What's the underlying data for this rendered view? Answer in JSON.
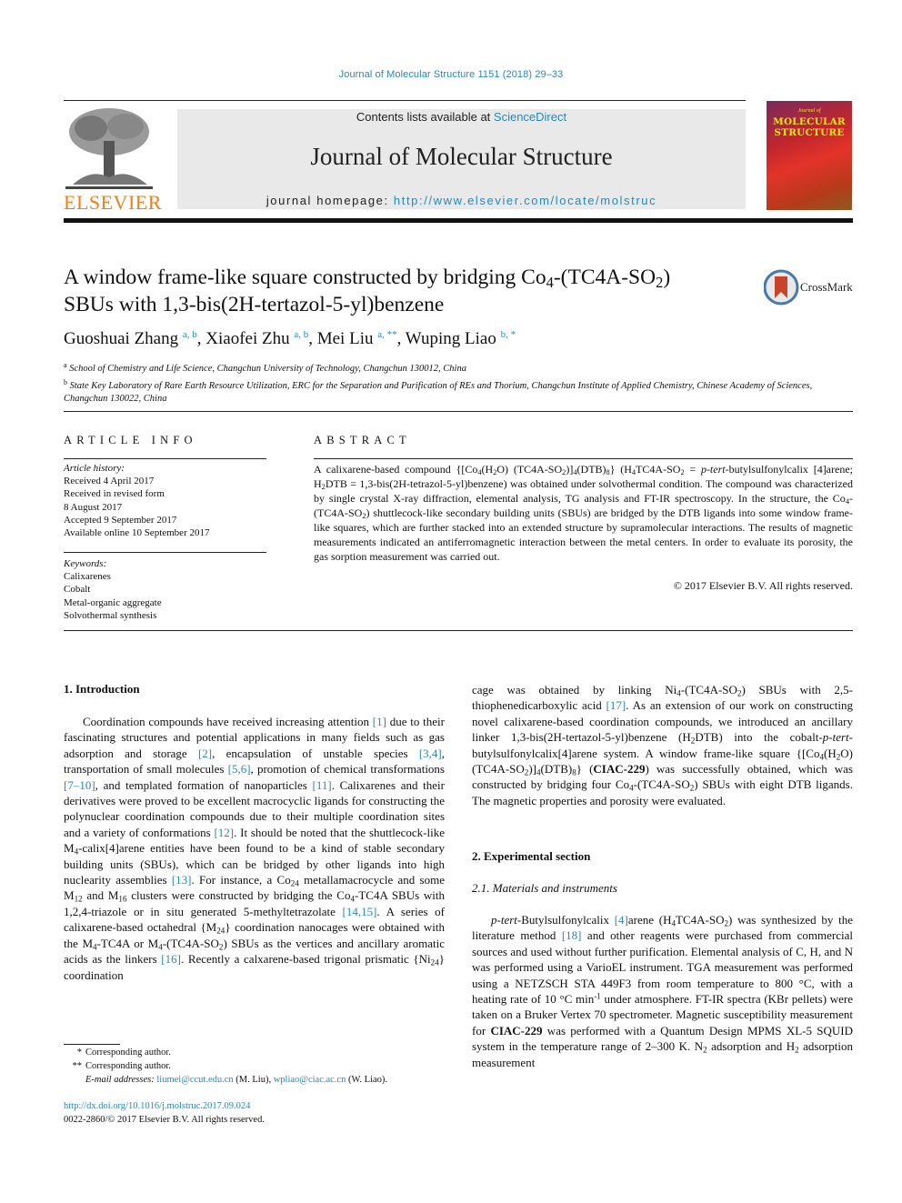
{
  "header": {
    "journal_ref": "Journal of Molecular Structure 1151 (2018) 29–33",
    "contents_prefix": "Contents lists available at ",
    "contents_link": "ScienceDirect",
    "journal_title": "Journal of Molecular Structure",
    "homepage_prefix": "journal homepage: ",
    "homepage_url": "http://www.elsevier.com/locate/molstruc",
    "publisher_logo": "ELSEVIER",
    "cover_small": "Journal of",
    "cover_line1": "MOLECULAR",
    "cover_line2": "STRUCTURE"
  },
  "article": {
    "title_part1": "A window frame-like square constructed by bridging Co",
    "title_sub1": "4",
    "title_part2": "-(TC4A-SO",
    "title_sub2": "2",
    "title_part3": ")",
    "title_line2": "SBUs with 1,3-bis(2H-tertazol-5-yl)benzene",
    "crossmark_label": "CrossMark",
    "authors": [
      {
        "name": "Guoshuai Zhang",
        "aff": "a, b",
        "sep": ", "
      },
      {
        "name": "Xiaofei Zhu",
        "aff": "a, b",
        "sep": ", "
      },
      {
        "name": "Mei Liu",
        "aff": "a, **",
        "sep": ", "
      },
      {
        "name": "Wuping Liao",
        "aff": "b, *",
        "sep": ""
      }
    ],
    "affiliations": [
      {
        "mark": "a",
        "text": "School of Chemistry and Life Science, Changchun University of Technology, Changchun 130012, China"
      },
      {
        "mark": "b",
        "text": "State Key Laboratory of Rare Earth Resource Utilization, ERC for the Separation and Purification of REs and Thorium, Changchun Institute of Applied Chemistry, Chinese Academy of Sciences, Changchun 130022, China"
      }
    ]
  },
  "article_info": {
    "heading": "ARTICLE INFO",
    "history_label": "Article history:",
    "history": [
      "Received 4 April 2017",
      "Received in revised form",
      "8 August 2017",
      "Accepted 9 September 2017",
      "Available online 10 September 2017"
    ],
    "keywords_label": "Keywords:",
    "keywords": [
      "Calixarenes",
      "Cobalt",
      "Metal-organic aggregate",
      "Solvothermal synthesis"
    ]
  },
  "abstract": {
    "heading": "ABSTRACT",
    "copyright": "© 2017 Elsevier B.V. All rights reserved."
  },
  "sections": {
    "intro_heading": "1.  Introduction",
    "exp_heading": "2.  Experimental section",
    "sub_heading": "2.1.  Materials and instruments"
  },
  "footnotes": {
    "star1": "*",
    "star1_text": "Corresponding author.",
    "star2": "**",
    "star2_text": "Corresponding author.",
    "email_label": "E-mail addresses:",
    "email1": "liumei@ccut.edu.cn",
    "email1_owner": " (M. Liu), ",
    "email2": "wpliao@ciac.ac.cn",
    "email2_owner": " (W. Liao).",
    "doi": "http://dx.doi.org/10.1016/j.molstruc.2017.09.024",
    "issn": "0022-2860/© 2017 Elsevier B.V. All rights reserved."
  },
  "colors": {
    "link": "#2a87b8",
    "elsevier_orange": "#f07e1b",
    "masthead_gray": "#e9e9e9"
  }
}
